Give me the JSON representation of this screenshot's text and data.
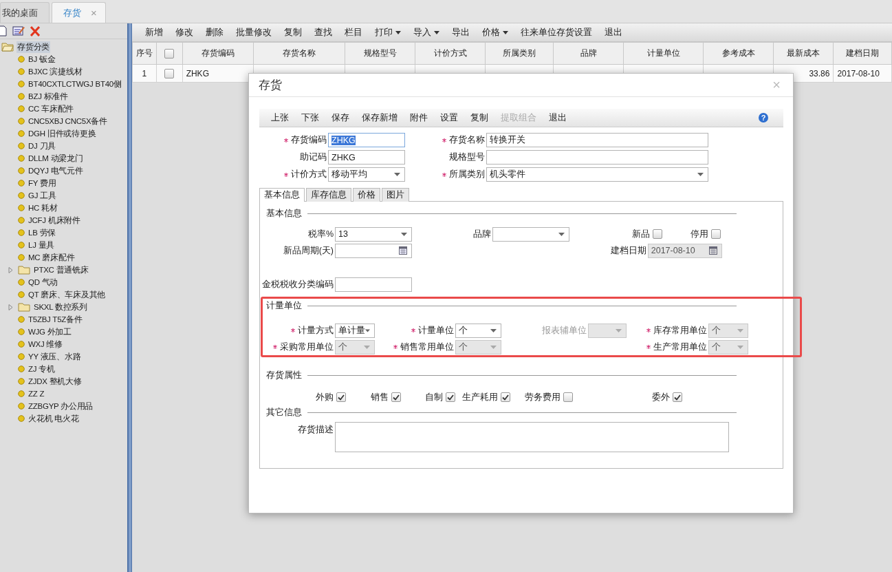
{
  "tabs": [
    {
      "label": "我的桌面",
      "selected": false
    },
    {
      "label": "存货",
      "selected": true,
      "close": "×"
    }
  ],
  "sidebar": {
    "tree": [
      {
        "label": "存货分类",
        "kind": "folder",
        "expanded": true,
        "selected": true,
        "children": [
          {
            "label": "BJ 钣金",
            "kind": "leaf",
            "selected": false
          },
          {
            "label": "BJXC 滨捷线材",
            "kind": "leaf",
            "selected": false
          },
          {
            "label": "BT40CXTLCTWGJ BT40侧",
            "kind": "leaf",
            "selected": false
          },
          {
            "label": "BZJ 标准件",
            "kind": "leaf",
            "selected": false
          },
          {
            "label": "CC 车床配件",
            "kind": "leaf",
            "selected": false
          },
          {
            "label": "CNC5XBJ CNC5X备件",
            "kind": "leaf",
            "selected": false
          },
          {
            "label": "DGH 旧件或待更换",
            "kind": "leaf",
            "selected": false
          },
          {
            "label": "DJ 刀具",
            "kind": "leaf",
            "selected": false
          },
          {
            "label": "DLLM 动梁龙门",
            "kind": "leaf",
            "selected": false
          },
          {
            "label": "DQYJ 电气元件",
            "kind": "leaf",
            "selected": false
          },
          {
            "label": "FY 费用",
            "kind": "leaf",
            "selected": false
          },
          {
            "label": "GJ 工具",
            "kind": "leaf",
            "selected": false
          },
          {
            "label": "HC 耗材",
            "kind": "leaf",
            "selected": false
          },
          {
            "label": "JCFJ 机床附件",
            "kind": "leaf",
            "selected": false
          },
          {
            "label": "LB 劳保",
            "kind": "leaf",
            "selected": false
          },
          {
            "label": "LJ 量具",
            "kind": "leaf",
            "selected": false
          },
          {
            "label": "MC 磨床配件",
            "kind": "leaf",
            "selected": false
          },
          {
            "label": "PTXC 普通铣床",
            "kind": "folder",
            "expanded": false,
            "selected": false
          },
          {
            "label": "QD 气动",
            "kind": "leaf",
            "selected": false
          },
          {
            "label": "QT 磨床、车床及其他",
            "kind": "leaf",
            "selected": false
          },
          {
            "label": "SKXL 数控系列",
            "kind": "folder",
            "expanded": false,
            "selected": false
          },
          {
            "label": "T5ZBJ T5Z备件",
            "kind": "leaf",
            "selected": false
          },
          {
            "label": "WJG 外加工",
            "kind": "leaf",
            "selected": false
          },
          {
            "label": "WXJ 维修",
            "kind": "leaf",
            "selected": false
          },
          {
            "label": "YY 液压、水路",
            "kind": "leaf",
            "selected": false
          },
          {
            "label": "ZJ 专机",
            "kind": "leaf",
            "selected": false
          },
          {
            "label": "ZJDX 整机大修",
            "kind": "leaf",
            "selected": false
          },
          {
            "label": "ZZ Z",
            "kind": "leaf",
            "selected": false
          },
          {
            "label": "ZZBGYP 办公用品",
            "kind": "leaf",
            "selected": false
          },
          {
            "label": "火花机 电火花",
            "kind": "leaf",
            "selected": false
          }
        ]
      }
    ]
  },
  "toolbar": [
    {
      "label": "新增",
      "dropdown": false
    },
    {
      "label": "修改",
      "dropdown": false
    },
    {
      "label": "删除",
      "dropdown": false
    },
    {
      "label": "批量修改",
      "dropdown": false
    },
    {
      "label": "复制",
      "dropdown": false
    },
    {
      "label": "查找",
      "dropdown": false
    },
    {
      "label": "栏目",
      "dropdown": false
    },
    {
      "label": "打印",
      "dropdown": true
    },
    {
      "label": "导入",
      "dropdown": true
    },
    {
      "label": "导出",
      "dropdown": false
    },
    {
      "label": "价格",
      "dropdown": true
    },
    {
      "label": "往来单位存货设置",
      "dropdown": false
    },
    {
      "label": "退出",
      "dropdown": false
    }
  ],
  "table": {
    "columns": [
      {
        "kind": "text",
        "label": "序号"
      },
      {
        "kind": "check",
        "checked": false
      },
      {
        "kind": "text",
        "label": "存货编码"
      },
      {
        "kind": "text",
        "label": "存货名称"
      },
      {
        "kind": "text",
        "label": "规格型号"
      },
      {
        "kind": "text",
        "label": "计价方式"
      },
      {
        "kind": "text",
        "label": "所属类别"
      },
      {
        "kind": "text",
        "label": "品牌"
      },
      {
        "kind": "text",
        "label": "计量单位"
      },
      {
        "kind": "text",
        "label": "参考成本"
      },
      {
        "kind": "text",
        "label": "最新成本"
      },
      {
        "kind": "text",
        "label": "建档日期"
      }
    ],
    "rows": [
      {
        "cells": [
          {
            "kind": "index",
            "text": "1"
          },
          {
            "kind": "check",
            "checked": false
          },
          {
            "kind": "text",
            "text": "ZHKG"
          },
          {
            "kind": "blank"
          },
          {
            "kind": "blank"
          },
          {
            "kind": "blank"
          },
          {
            "kind": "blank"
          },
          {
            "kind": "blank"
          },
          {
            "kind": "blank"
          },
          {
            "kind": "blank"
          },
          {
            "kind": "number",
            "text": "33.86"
          },
          {
            "kind": "text",
            "text": "2017-08-10"
          }
        ]
      }
    ]
  },
  "dialog": {
    "title": "存货",
    "close": "×",
    "help": "?",
    "toolbar": [
      {
        "label": "上张",
        "disabled": false
      },
      {
        "label": "下张",
        "disabled": false
      },
      {
        "label": "保存",
        "disabled": false
      },
      {
        "label": "保存新增",
        "disabled": false
      },
      {
        "label": "附件",
        "disabled": false
      },
      {
        "label": "设置",
        "disabled": false
      },
      {
        "label": "复制",
        "disabled": false
      },
      {
        "label": "提取组合",
        "disabled": true
      },
      {
        "label": "退出",
        "disabled": false
      }
    ],
    "header_fields": [
      {
        "label": "存货编码",
        "required": true,
        "kind": "text",
        "value": "ZHKG",
        "highlighted": true
      },
      {
        "label": "存货名称",
        "required": true,
        "kind": "text",
        "value": "转换开关",
        "highlighted": false
      },
      {
        "label": "助记码",
        "required": false,
        "kind": "text",
        "value": "ZHKG",
        "highlighted": false
      },
      {
        "label": "规格型号",
        "required": false,
        "kind": "text",
        "highlighted": false
      },
      {
        "label": "计价方式",
        "required": true,
        "kind": "select",
        "value": "移动平均"
      },
      {
        "label": "所属类别",
        "required": true,
        "kind": "select",
        "value": "机头零件"
      }
    ],
    "tabs": [
      {
        "label": "基本信息",
        "selected": true
      },
      {
        "label": "库存信息",
        "selected": false
      },
      {
        "label": "价格",
        "selected": false
      },
      {
        "label": "图片",
        "selected": false
      }
    ],
    "sections": [
      {
        "kind": "basic",
        "title": "基本信息",
        "fields": [
          {
            "label": "税率%",
            "kind": "select",
            "value": "13",
            "disabled": false
          },
          {
            "label": "品牌",
            "kind": "select",
            "disabled": false
          },
          {
            "label": "新品",
            "kind": "check",
            "checked": false
          },
          {
            "label": "停用",
            "kind": "check",
            "checked": false
          },
          {
            "label": "新品周期(天)",
            "kind": "date",
            "disabled": false
          },
          {
            "label": "建档日期",
            "kind": "date",
            "value": "2017-08-10",
            "disabled": true
          },
          {
            "label": "金税税收分类编码",
            "kind": "text"
          }
        ]
      },
      {
        "kind": "units",
        "title": "计量单位",
        "highlight": true,
        "fields": [
          {
            "label": "计量方式",
            "required": true,
            "kind": "select",
            "value": "单计量",
            "disabled": false
          },
          {
            "label": "计量单位",
            "required": true,
            "kind": "select",
            "value": "个",
            "disabled": false
          },
          {
            "label": "报表辅单位",
            "required": false,
            "kind": "select",
            "disabled": true
          },
          {
            "label": "库存常用单位",
            "required": true,
            "kind": "select",
            "value": "个",
            "disabled": true
          },
          {
            "label": "采购常用单位",
            "required": true,
            "kind": "select",
            "value": "个",
            "disabled": true
          },
          {
            "label": "销售常用单位",
            "required": true,
            "kind": "select",
            "value": "个",
            "disabled": true
          },
          {
            "label": "生产常用单位",
            "required": true,
            "kind": "select",
            "value": "个",
            "disabled": true
          }
        ]
      },
      {
        "kind": "attributes",
        "title": "存货属性",
        "fields": [
          {
            "label": "外购",
            "kind": "check",
            "checked": true
          },
          {
            "label": "销售",
            "kind": "check",
            "checked": true
          },
          {
            "label": "自制",
            "kind": "check",
            "checked": true
          },
          {
            "label": "生产耗用",
            "kind": "check",
            "checked": true
          },
          {
            "label": "劳务费用",
            "kind": "check",
            "checked": false
          },
          {
            "label": "委外",
            "kind": "check",
            "checked": true
          }
        ]
      },
      {
        "kind": "other",
        "title": "其它信息",
        "fields": [
          {
            "label": "存货描述",
            "kind": "textarea"
          }
        ]
      }
    ]
  }
}
